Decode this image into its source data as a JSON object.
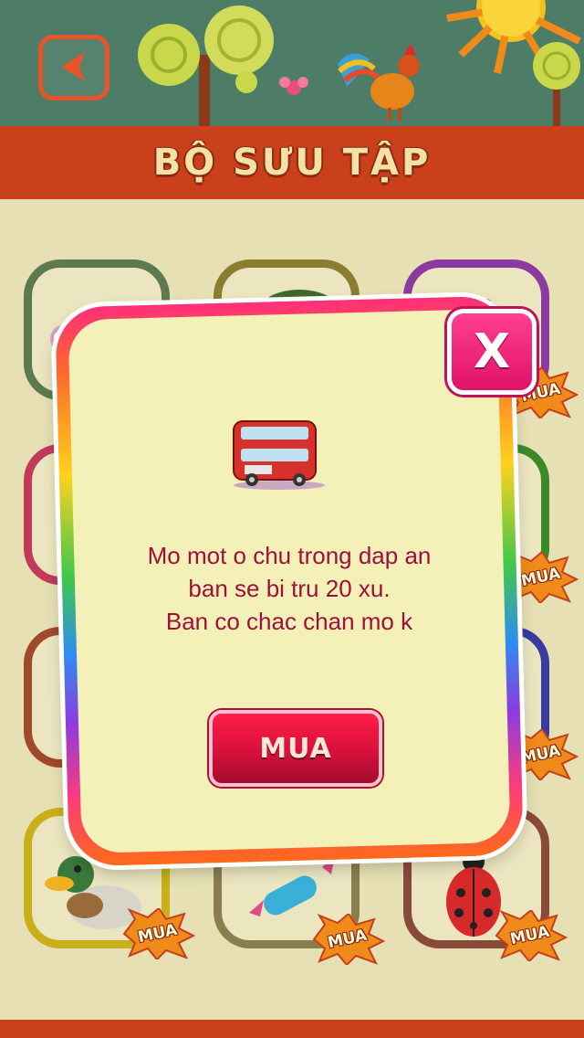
{
  "header": {
    "title": "BỘ SƯU TẬP"
  },
  "grid": {
    "badge_label": "MUA",
    "items": [
      {
        "name": "animal-1",
        "locked": false
      },
      {
        "name": "tree",
        "locked": false
      },
      {
        "name": "bus",
        "locked": true
      },
      {
        "name": "item-4",
        "locked": false
      },
      {
        "name": "item-5",
        "locked": false
      },
      {
        "name": "item-6",
        "locked": true
      },
      {
        "name": "item-7",
        "locked": false
      },
      {
        "name": "item-8",
        "locked": false
      },
      {
        "name": "item-9",
        "locked": true
      },
      {
        "name": "duck",
        "locked": true
      },
      {
        "name": "candy",
        "locked": true
      },
      {
        "name": "ladybug",
        "locked": true
      }
    ]
  },
  "dialog": {
    "icon": "bus-icon",
    "message_line1": "Mo mot o chu trong dap an",
    "message_line2": "ban se bi tru 20 xu.",
    "message_line3": "Ban co chac chan mo k",
    "buy_label": "MUA",
    "close_label": "X"
  },
  "colors": {
    "header_bg": "#c9401a",
    "dialog_bg": "#f4f1b8",
    "message_text": "#a0103c",
    "buy_button": "#d8103a",
    "close_button": "#e0126a"
  }
}
